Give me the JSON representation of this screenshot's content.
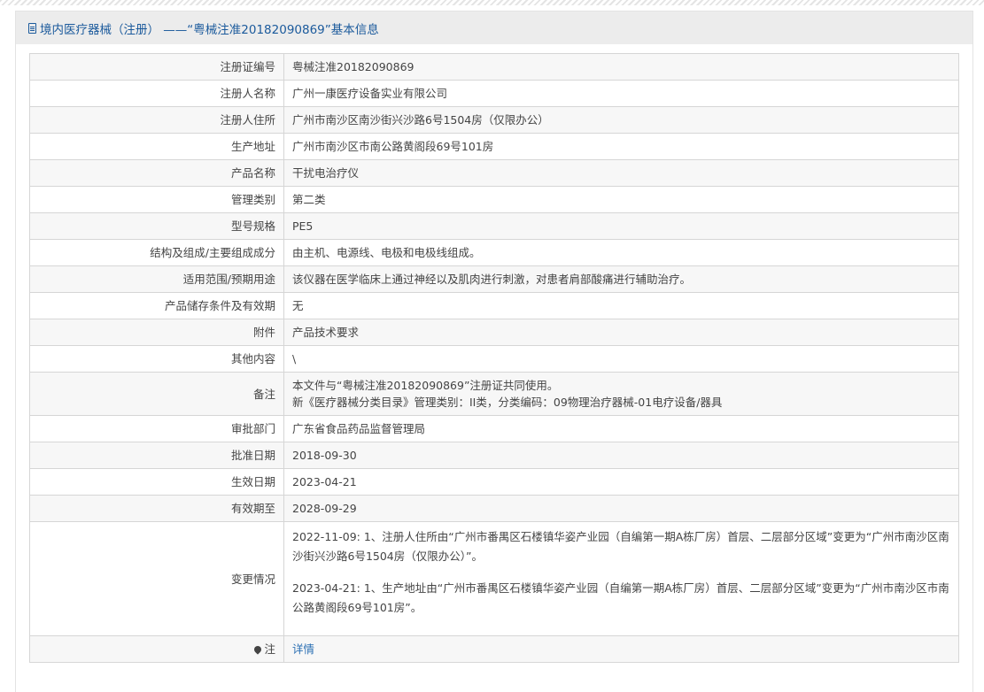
{
  "header": {
    "title": "境内医疗器械（注册） ——“粤械注准20182090869”基本信息"
  },
  "rows": [
    {
      "label": "注册证编号",
      "value": "粤械注准20182090869"
    },
    {
      "label": "注册人名称",
      "value": "广州一康医疗设备实业有限公司"
    },
    {
      "label": "注册人住所",
      "value": "广州市南沙区南沙街兴沙路6号1504房（仅限办公）"
    },
    {
      "label": "生产地址",
      "value": "广州市南沙区市南公路黄阁段69号101房"
    },
    {
      "label": "产品名称",
      "value": "干扰电治疗仪"
    },
    {
      "label": "管理类别",
      "value": "第二类"
    },
    {
      "label": "型号规格",
      "value": "PE5"
    },
    {
      "label": "结构及组成/主要组成成分",
      "value": "由主机、电源线、电极和电极线组成。"
    },
    {
      "label": "适用范围/预期用途",
      "value": "该仪器在医学临床上通过神经以及肌肉进行刺激，对患者肩部酸痛进行辅助治疗。"
    },
    {
      "label": "产品储存条件及有效期",
      "value": "无"
    },
    {
      "label": "附件",
      "value": "产品技术要求"
    },
    {
      "label": "其他内容",
      "value": "\\"
    }
  ],
  "remark": {
    "label": "备注",
    "line1": "本文件与“粤械注准20182090869”注册证共同使用。",
    "line2": "新《医疗器械分类目录》管理类别：II类，分类编码：09物理治疗器械-01电疗设备/器具"
  },
  "rows2": [
    {
      "label": "审批部门",
      "value": "广东省食品药品监督管理局"
    },
    {
      "label": "批准日期",
      "value": "2018-09-30"
    },
    {
      "label": "生效日期",
      "value": "2023-04-21"
    },
    {
      "label": "有效期至",
      "value": "2028-09-29"
    }
  ],
  "changes": {
    "label": "变更情况",
    "entries": [
      "2022-11-09: 1、注册人住所由“广州市番禺区石楼镇华姿产业园（自编第一期A栋厂房）首层、二层部分区域”变更为“广州市南沙区南沙街兴沙路6号1504房（仅限办公）”。",
      "2023-04-21: 1、生产地址由“广州市番禺区石楼镇华姿产业园（自编第一期A栋厂房）首层、二层部分区域”变更为“广州市南沙区市南公路黄阁段69号101房”。"
    ]
  },
  "note": {
    "label": "注",
    "link_text": "详情",
    "icon": "map-pin-icon"
  }
}
